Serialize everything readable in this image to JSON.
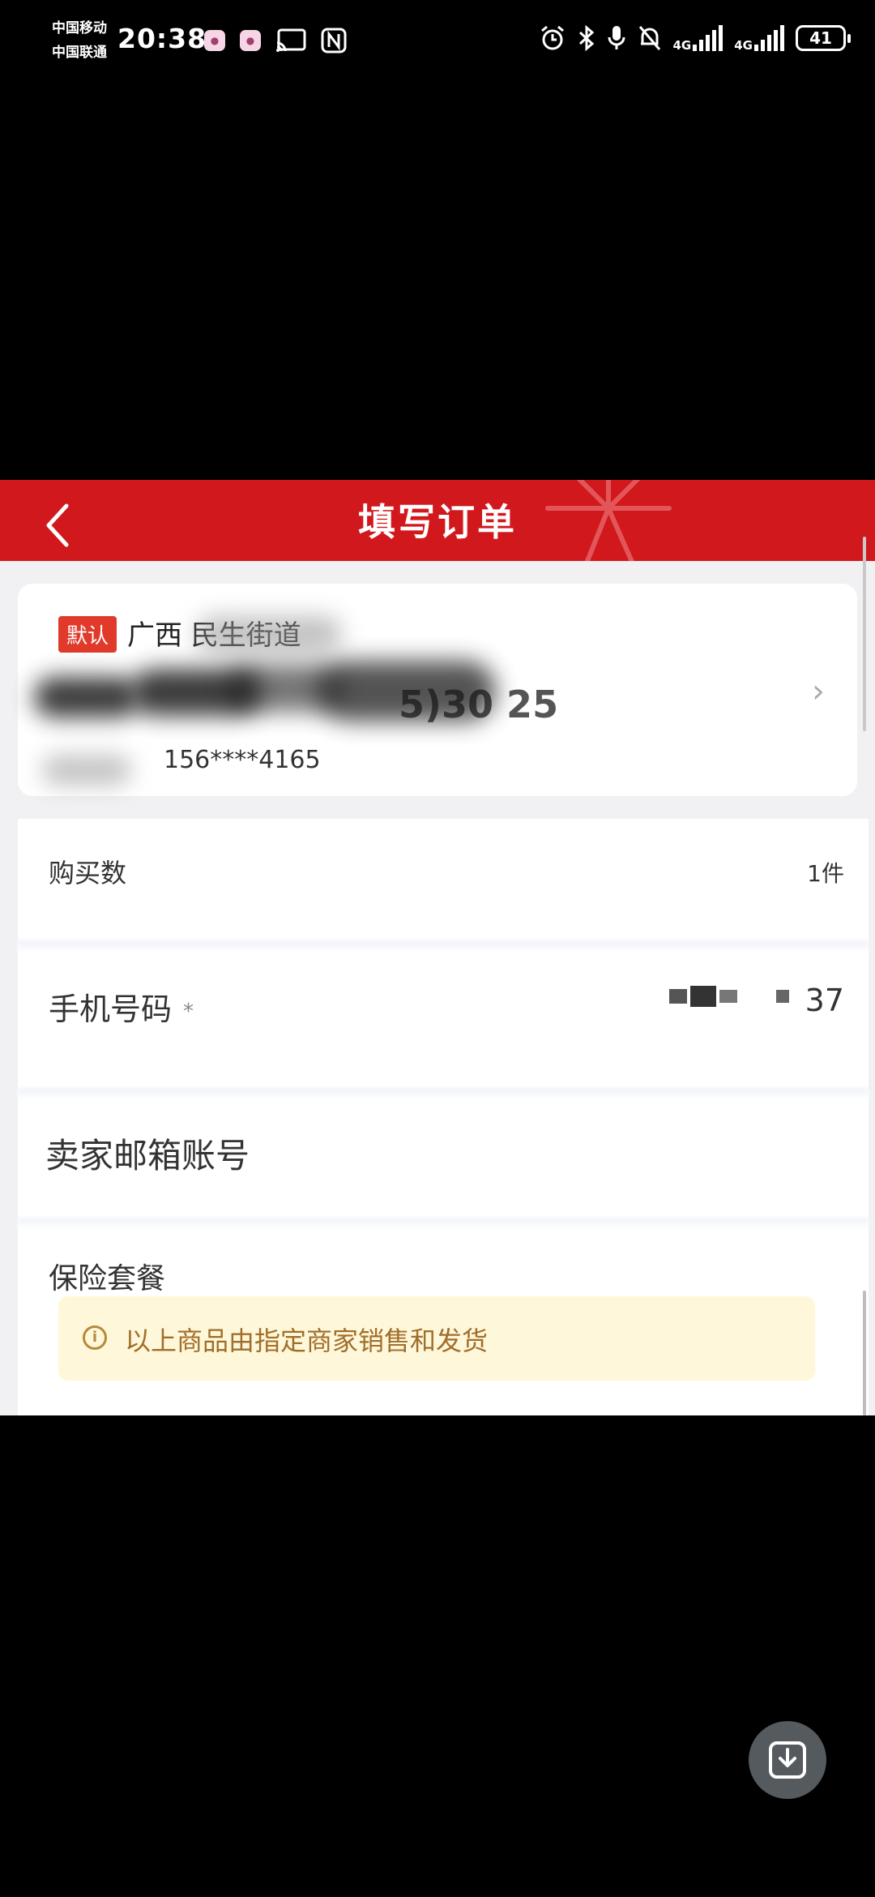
{
  "status_bar": {
    "carrier_1": "中国移动",
    "carrier_2": "中国联通",
    "time": "20:38",
    "network_1": "4G",
    "network_2": "4G",
    "battery": "41",
    "icons": [
      "app-notification-icon",
      "app-notification-icon",
      "cast-icon",
      "nfc-icon",
      "alarm-icon",
      "bluetooth-icon",
      "microphone-icon",
      "mute-icon",
      "signal-icon",
      "signal-icon",
      "battery-icon"
    ]
  },
  "header": {
    "title": "填写订单",
    "back_icon": "chevron-left-icon",
    "background": "#d1181d"
  },
  "address": {
    "default_tag": "默认",
    "line": "广西 民生街道",
    "name_suffix": "5)30 25",
    "phone": "156****4165",
    "arrow_icon": "chevron-right-icon"
  },
  "form": {
    "quantity_label": "购买数",
    "quantity_value": "1件",
    "phone_label": "手机号码",
    "phone_required": "*",
    "phone_value_suffix": "37",
    "email_label": "卖家邮箱账号",
    "insurance_label": "保险套餐"
  },
  "notice": {
    "icon": "info-icon",
    "text": "以上商品由指定商家销售和发货",
    "background": "#fff7d9"
  },
  "overlay": {
    "download_icon": "download-icon"
  }
}
